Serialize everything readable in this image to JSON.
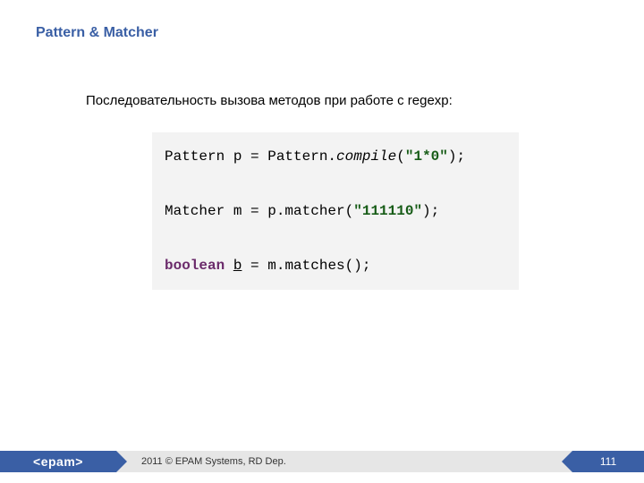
{
  "title": "Pattern & Matcher",
  "subtitle": "Последовательность вызова методов при работе с regexp:",
  "code": {
    "line1": {
      "pre": "Pattern p = Pattern.",
      "method": "compile",
      "open": "(",
      "str": "\"1*0\"",
      "close": ");"
    },
    "line2": {
      "text": "Matcher m = p.matcher(",
      "str": "\"111110\"",
      "close": ");"
    },
    "line3": {
      "kw": "boolean",
      "sp": " ",
      "var": "b",
      "rest": " = m.matches();"
    }
  },
  "footer": {
    "logo": "<epam>",
    "copyright": "2011 © EPAM Systems, RD Dep.",
    "page": "111"
  }
}
